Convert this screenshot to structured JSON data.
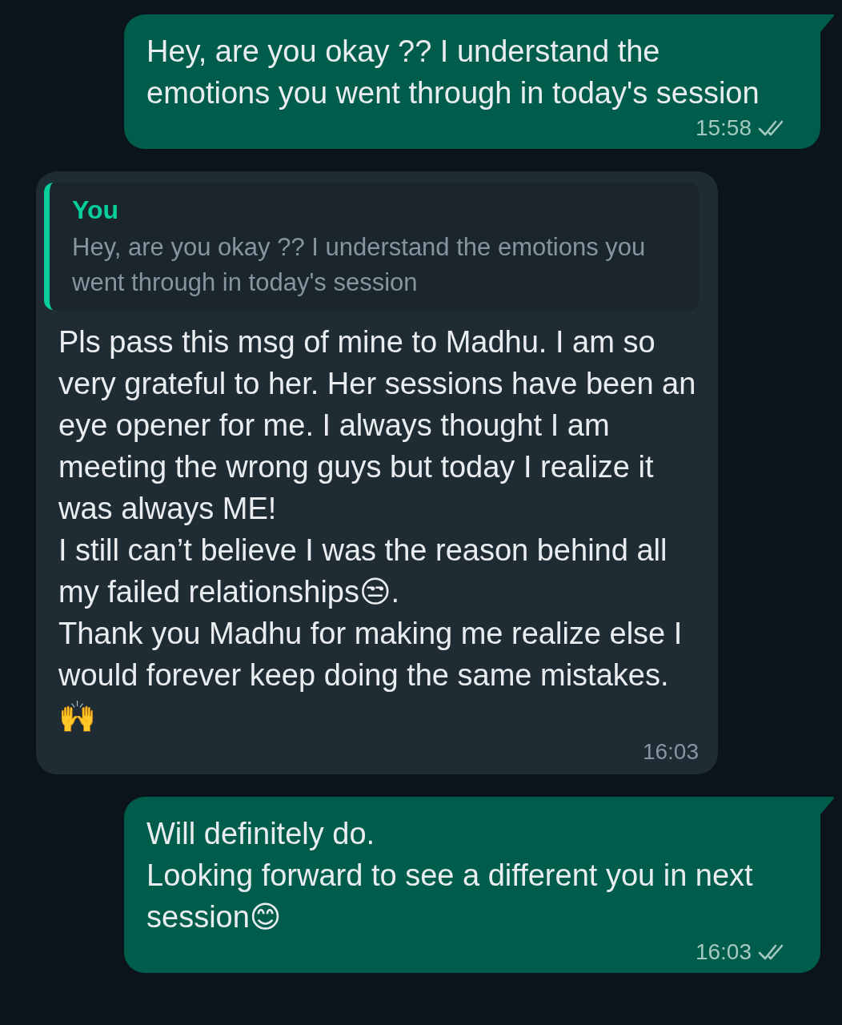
{
  "messages": [
    {
      "kind": "outgoing",
      "text": "Hey, are you okay ?? I understand the emotions you went through in today's session",
      "time": "15:58",
      "read": false
    },
    {
      "kind": "incoming",
      "reply": {
        "author": "You",
        "text": "Hey, are you okay ?? I understand the emotions you went through in today's session"
      },
      "text": "Pls pass this msg of mine to Madhu. I am so very grateful to her. Her sessions have been an eye opener for me. I always thought I am meeting the wrong guys but today I realize it was always ME!\nI still can’t believe I was the reason behind all my failed relationships😒.\nThank you Madhu for making me realize else I would forever keep doing the same mistakes.🙌",
      "time": "16:03"
    },
    {
      "kind": "outgoing",
      "text": "Will definitely do.\nLooking forward to see a different you in next session😊",
      "time": "16:03",
      "read": false
    }
  ]
}
